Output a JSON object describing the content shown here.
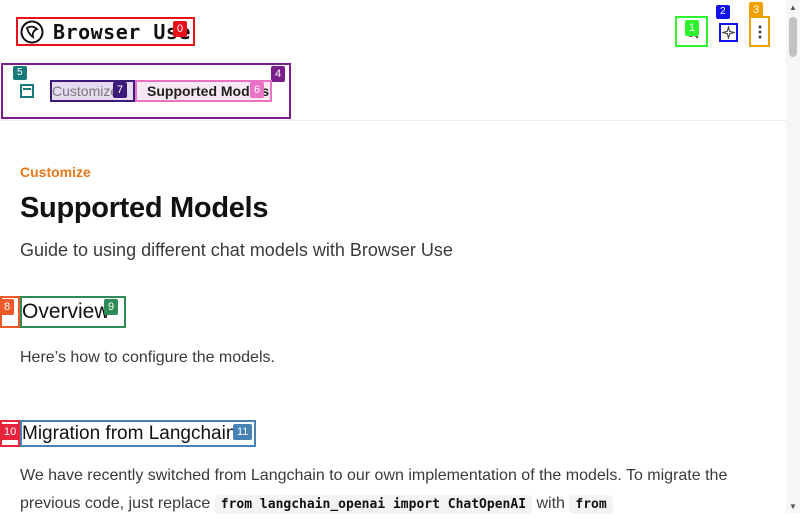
{
  "header": {
    "logo_text": "Browser Use",
    "search_icon": "search-icon",
    "ai_icon": "sparkle-icon",
    "more_icon": "more-vertical-icon"
  },
  "breadcrumb": {
    "parent": "Customize",
    "separator": ">",
    "current": "Supported Models"
  },
  "page": {
    "eyebrow": "Customize",
    "title": "Supported Models",
    "description": "Guide to using different chat models with Browser Use"
  },
  "sections": {
    "overview_heading": "Overview",
    "overview_text": "Here’s how to configure the models.",
    "migration_heading": "Migration from Langchain",
    "migration_text_1": "We have recently switched from Langchain to our own implementation of the models. To migrate the previous code, just replace",
    "migration_code_1": "from langchain_openai import ChatOpenAI",
    "migration_text_2": "with",
    "migration_code_2": "from"
  },
  "badges": [
    "0",
    "1",
    "2",
    "3",
    "4",
    "5",
    "6",
    "7",
    "8",
    "9",
    "10",
    "11"
  ],
  "colors": {
    "accent": "#e8761a",
    "text": "#1f1f1f"
  }
}
